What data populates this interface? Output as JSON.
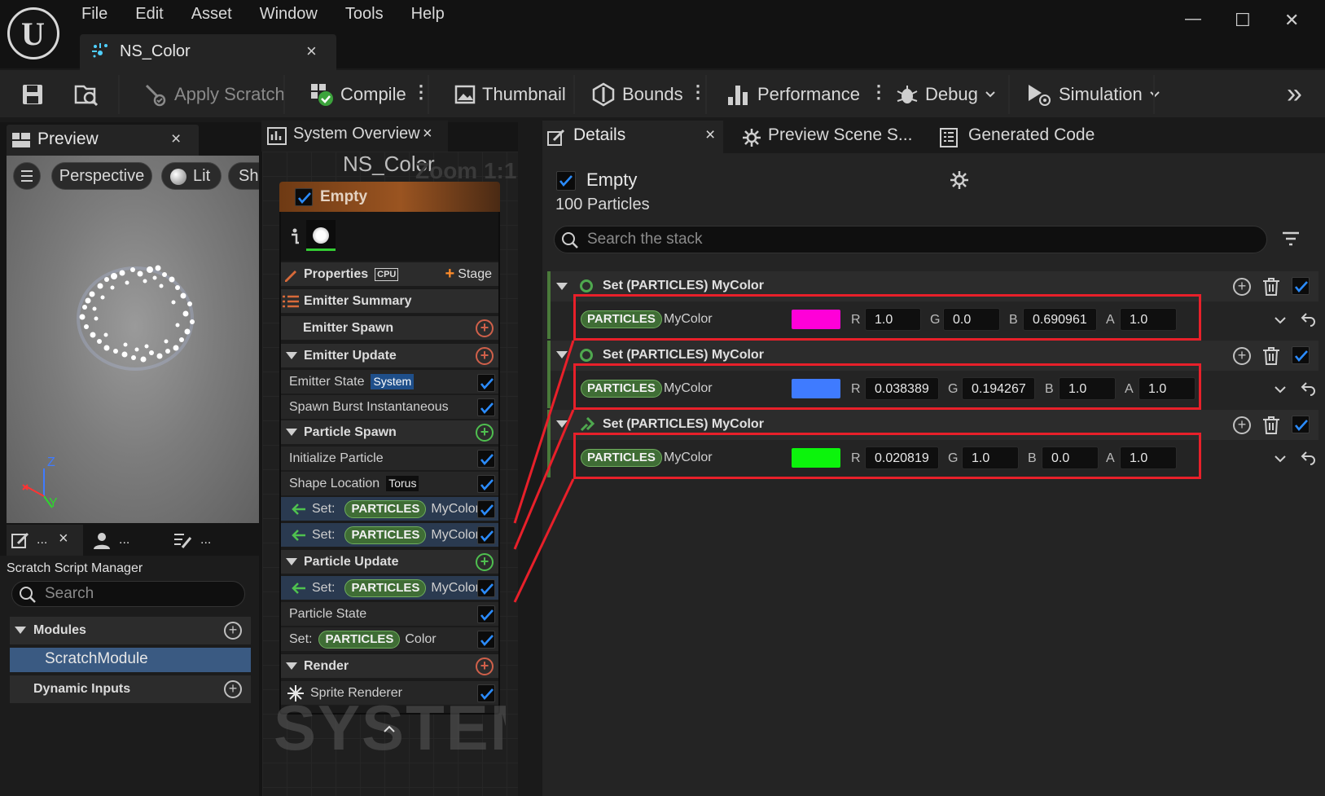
{
  "app": {
    "menu": [
      "File",
      "Edit",
      "Asset",
      "Window",
      "Tools",
      "Help"
    ],
    "tab_title": "NS_Color",
    "tab_close": "×"
  },
  "window": {
    "minimize": "—",
    "maximize": "☐",
    "close": "✕"
  },
  "toolbar": {
    "apply_scratch": "Apply Scratch",
    "compile": "Compile",
    "thumbnail": "Thumbnail",
    "bounds": "Bounds",
    "performance": "Performance",
    "debug": "Debug",
    "simulation": "Simulation",
    "overflow": "»",
    "more": "⋮"
  },
  "preview": {
    "tab": "Preview",
    "close": "×",
    "perspective": "Perspective",
    "lit": "Lit",
    "show": "Sh",
    "axis_z": "Z",
    "axis_y": "Y"
  },
  "bottom_left": {
    "tab1_dots": "...",
    "tab2_dots": "...",
    "tab3_dots": "...",
    "close": "×",
    "title": "Scratch Script Manager",
    "search_placeholder": "Search",
    "modules": "Modules",
    "scratch_module": "ScratchModule",
    "dynamic_inputs": "Dynamic Inputs"
  },
  "system": {
    "tab": "System Overview",
    "close": "×",
    "title": "NS_Color",
    "zoom": "Zoom 1:1",
    "watermark": "SYSTEM",
    "emitter": "Empty",
    "properties": "Properties",
    "cpu": "CPU",
    "stage": "Stage",
    "emitter_summary": "Emitter Summary",
    "emitter_spawn": "Emitter Spawn",
    "emitter_update": "Emitter Update",
    "emitter_state": "Emitter State",
    "system_tag": "System",
    "spawn_burst": "Spawn Burst Instantaneous",
    "particle_spawn": "Particle Spawn",
    "initialize_particle": "Initialize Particle",
    "shape_location": "Shape Location",
    "torus_tag": "Torus",
    "set": "Set:",
    "particles": "PARTICLES",
    "mycolor": "MyColor",
    "particle_update": "Particle Update",
    "particle_state": "Particle State",
    "color": "Color",
    "render": "Render",
    "sprite_renderer": "Sprite Renderer"
  },
  "details": {
    "tab": "Details",
    "close": "×",
    "preview_scene": "Preview Scene S...",
    "generated_code": "Generated Code",
    "emitter_name": "Empty",
    "particles_count": "100 Particles",
    "search_placeholder": "Search the stack",
    "modules": [
      {
        "title": "Set (PARTICLES) MyColor",
        "param": "MyColor",
        "tag": "PARTICLES",
        "swatch": "#ff00d8",
        "r": "1.0",
        "g": "0.0",
        "b": "0.690961",
        "a": "1.0"
      },
      {
        "title": "Set (PARTICLES) MyColor",
        "param": "MyColor",
        "tag": "PARTICLES",
        "swatch": "#3f7bff",
        "r": "0.038389",
        "g": "0.194267",
        "b": "1.0",
        "a": "1.0"
      },
      {
        "title": "Set (PARTICLES) MyColor",
        "param": "MyColor",
        "tag": "PARTICLES",
        "swatch": "#0cf40c",
        "r": "0.020819",
        "g": "1.0",
        "b": "0.0",
        "a": "1.0"
      }
    ],
    "labels": {
      "r": "R",
      "g": "G",
      "b": "B",
      "a": "A"
    }
  },
  "colors": {
    "accent": "#0070e0",
    "highlight": "#e8202a",
    "pill_green": "#3f6d35",
    "emitter_orange": "#8a4a1e"
  }
}
